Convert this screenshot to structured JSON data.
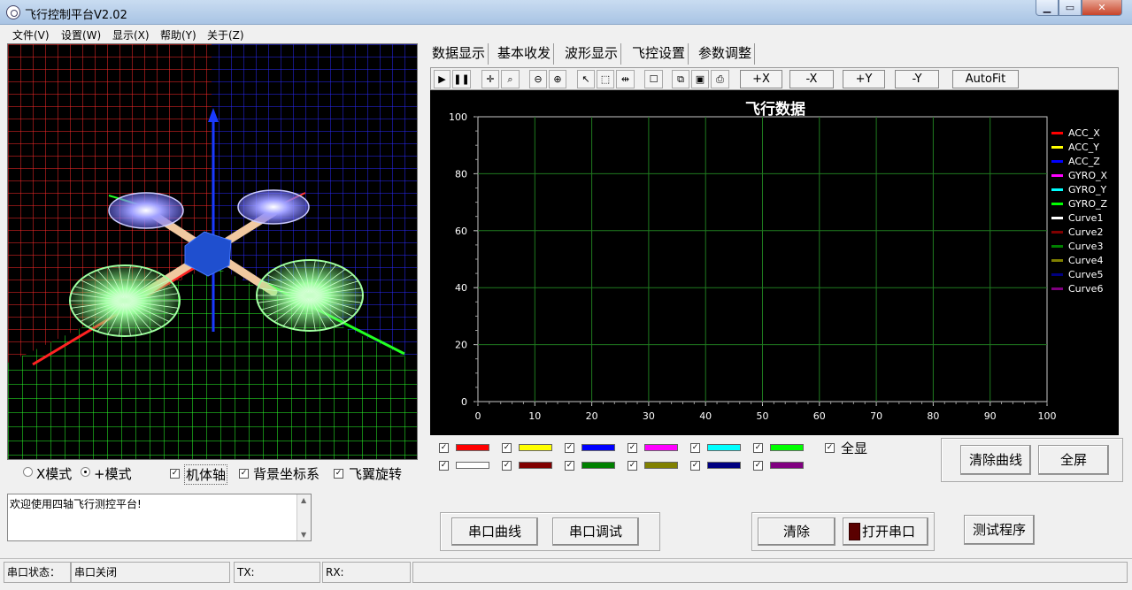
{
  "window": {
    "title": "飞行控制平台V2.02",
    "min_glyph": "▁",
    "max_glyph": "▭",
    "close_glyph": "✕"
  },
  "menu": [
    "文件(V)",
    "设置(W)",
    "显示(X)",
    "帮助(Y)",
    "关于(Z)"
  ],
  "view3d": {
    "mode_x_label": "X模式",
    "mode_plus_label": "+模式",
    "mode_selected": "+模式",
    "checkbox_body_axis": {
      "label": "机体轴",
      "checked": true
    },
    "checkbox_bg_coords": {
      "label": "背景坐标系",
      "checked": true
    },
    "checkbox_rotor_spin": {
      "label": "飞翼旋转",
      "checked": true
    }
  },
  "tabs": [
    "数据显示",
    "基本收发",
    "波形显示",
    "飞控设置",
    "参数调整"
  ],
  "active_tab": "波形显示",
  "toolbar": {
    "plus_x": "+X",
    "minus_x": "-X",
    "plus_y": "+Y",
    "minus_y": "-Y",
    "autofit": "AutoFit"
  },
  "chart_data": {
    "type": "line",
    "title": "飞行数据",
    "xlim": [
      0,
      100
    ],
    "ylim": [
      0,
      100
    ],
    "x_ticks": [
      0,
      10,
      20,
      30,
      40,
      50,
      60,
      70,
      80,
      90,
      100
    ],
    "y_ticks": [
      0,
      20,
      40,
      60,
      80,
      100
    ],
    "grid": true,
    "legend_position": "right",
    "series": [
      {
        "name": "ACC_X",
        "color": "#ff0000",
        "values": []
      },
      {
        "name": "ACC_Y",
        "color": "#ffff00",
        "values": []
      },
      {
        "name": "ACC_Z",
        "color": "#0000ff",
        "values": []
      },
      {
        "name": "GYRO_X",
        "color": "#ff00ff",
        "values": []
      },
      {
        "name": "GYRO_Y",
        "color": "#00ffff",
        "values": []
      },
      {
        "name": "GYRO_Z",
        "color": "#00ff00",
        "values": []
      },
      {
        "name": "Curve1",
        "color": "#ffffff",
        "values": []
      },
      {
        "name": "Curve2",
        "color": "#800000",
        "values": []
      },
      {
        "name": "Curve3",
        "color": "#008000",
        "values": []
      },
      {
        "name": "Curve4",
        "color": "#808000",
        "values": []
      },
      {
        "name": "Curve5",
        "color": "#000080",
        "values": []
      },
      {
        "name": "Curve6",
        "color": "#800080",
        "values": []
      }
    ]
  },
  "series_panel": {
    "show_all_label": "全显",
    "show_all_checked": true,
    "check_glyph": "✓"
  },
  "buttons": {
    "clear_curves": "清除曲线",
    "fullscreen": "全屏",
    "serial_curve": "串口曲线",
    "serial_debug": "串口调试",
    "clear": "清除",
    "open_port": "打开串口",
    "test_program": "测试程序"
  },
  "log": {
    "text": "欢迎使用四轴飞行测控平台!"
  },
  "status": {
    "port_status_label": "串口状态：",
    "port_status_value": "串口关闭",
    "tx_label": "TX:",
    "rx_label": "RX:"
  }
}
